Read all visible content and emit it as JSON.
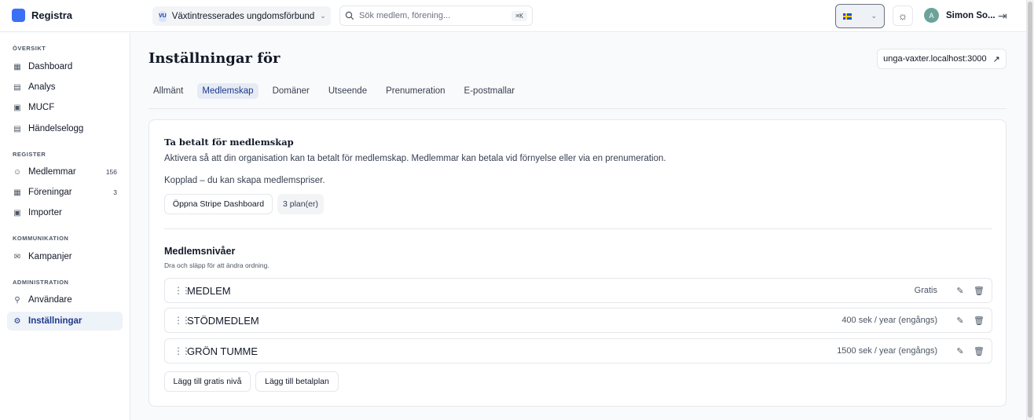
{
  "app": {
    "name": "Registra"
  },
  "org": {
    "badge": "VU",
    "name": "Växtintresserades ungdomsförbund"
  },
  "search": {
    "placeholder": "Sök medlem, förening...",
    "shortcut": "⌘K"
  },
  "user": {
    "initials": "A",
    "name": "Simon So..."
  },
  "sidebar": {
    "sections": [
      {
        "title": "ÖVERSIKT",
        "items": [
          {
            "label": "Dashboard",
            "icon": "dashboard-icon"
          },
          {
            "label": "Analys",
            "icon": "chart-icon"
          },
          {
            "label": "MUCF",
            "icon": "document-icon"
          },
          {
            "label": "Händelselogg",
            "icon": "log-icon"
          }
        ]
      },
      {
        "title": "REGISTER",
        "items": [
          {
            "label": "Medlemmar",
            "count": "156",
            "icon": "users-icon"
          },
          {
            "label": "Föreningar",
            "count": "3",
            "icon": "building-icon"
          },
          {
            "label": "Importer",
            "icon": "import-icon"
          }
        ]
      },
      {
        "title": "KOMMUNIKATION",
        "items": [
          {
            "label": "Kampanjer",
            "icon": "mail-icon"
          }
        ]
      },
      {
        "title": "ADMINISTRATION",
        "items": [
          {
            "label": "Användare",
            "icon": "user-key-icon"
          },
          {
            "label": "Inställningar",
            "icon": "gear-icon",
            "active": true
          }
        ]
      }
    ]
  },
  "main": {
    "title": "Inställningar för",
    "site_url": "unga-vaxter.localhost:3000",
    "tabs": [
      "Allmänt",
      "Medlemskap",
      "Domäner",
      "Utseende",
      "Prenumeration",
      "E-postmallar"
    ],
    "active_tab": "Medlemskap"
  },
  "payment": {
    "title": "Ta betalt för medlemskap",
    "description": "Aktivera så att din organisation kan ta betalt för medlemskap. Medlemmar kan betala vid förnyelse eller via en prenumeration.",
    "status": "Kopplad – du kan skapa medlemspriser.",
    "stripe_button": "Öppna Stripe Dashboard",
    "plans_badge": "3 plan(er)"
  },
  "tiers": {
    "title": "Medlemsnivåer",
    "hint": "Dra och släpp för att ändra ordning.",
    "items": [
      {
        "name": "MEDLEM",
        "price": "Gratis"
      },
      {
        "name": "STÖDMEDLEM",
        "price": "400 sek / year (engångs)"
      },
      {
        "name": "GRÖN TUMME",
        "price": "1500 sek / year (engångs)"
      }
    ],
    "add_free_button": "Lägg till gratis nivå",
    "add_paid_button": "Lägg till betalplan"
  },
  "colors": {
    "brand": "#3b6ff5",
    "active_bg": "#eef2f9",
    "active_text": "#1e3a8a"
  }
}
